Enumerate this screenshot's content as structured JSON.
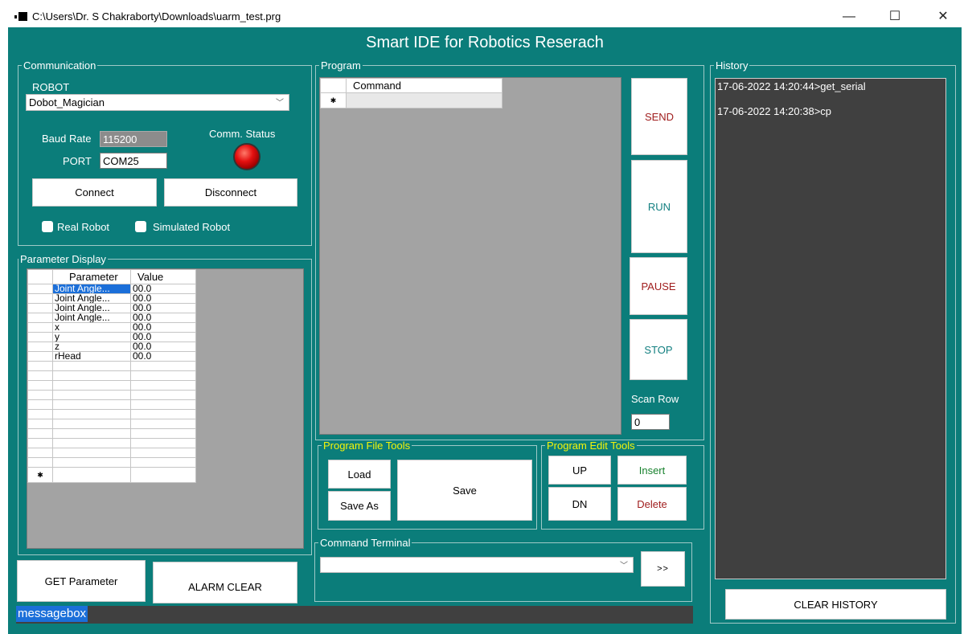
{
  "window": {
    "title": "C:\\Users\\Dr. S Chakraborty\\Downloads\\uarm_test.prg",
    "minimize": "—",
    "maximize": "☐",
    "close": "✕"
  },
  "app": {
    "heading": "Smart IDE for Robotics Reserach"
  },
  "colors": {
    "background": "#0b7d7a",
    "selection": "#1b6fd9",
    "dark_panel": "#404040"
  },
  "communication": {
    "legend": "Communication",
    "robot_label": "ROBOT",
    "robot_value": "Dobot_Magician",
    "baud_label": "Baud Rate",
    "baud_value": "115200",
    "port_label": "PORT",
    "port_value": "COM25",
    "status_label": "Comm. Status",
    "connect": "Connect",
    "disconnect": "Disconnect",
    "real_robot": "Real Robot",
    "simulated_robot": "Simulated Robot"
  },
  "params": {
    "legend": "Parameter Display",
    "col_param": "Parameter",
    "col_value": "Value",
    "rows": [
      [
        "Joint Angle...",
        "00.0"
      ],
      [
        "Joint Angle...",
        "00.0"
      ],
      [
        "Joint Angle...",
        "00.0"
      ],
      [
        "Joint Angle...",
        "00.0"
      ],
      [
        "x",
        "00.0"
      ],
      [
        "y",
        "00.0"
      ],
      [
        "z",
        "00.0"
      ],
      [
        "rHead",
        "00.0"
      ]
    ],
    "new_row_marker": "✱"
  },
  "bottom_left": {
    "get_parameter": "GET Parameter",
    "alarm_clear": "ALARM CLEAR"
  },
  "program": {
    "legend": "Program",
    "col_command": "Command",
    "new_row_marker": "✱",
    "send": "SEND",
    "run": "RUN",
    "pause": "PAUSE",
    "stop": "STOP",
    "scan_row_label": "Scan Row",
    "scan_row_value": "0"
  },
  "file_tools": {
    "legend": "Program File Tools",
    "load": "Load",
    "save_as": "Save As",
    "save": "Save"
  },
  "edit_tools": {
    "legend": "Program Edit Tools",
    "up": "UP",
    "insert": "Insert",
    "dn": "DN",
    "delete": "Delete"
  },
  "terminal": {
    "legend": "Command Terminal",
    "value": "",
    "send": ">>"
  },
  "history": {
    "legend": "History",
    "entries": [
      "17-06-2022 14:20:44>get_serial",
      "17-06-2022 14:20:38>cp"
    ],
    "clear": "CLEAR HISTORY"
  },
  "messagebox": {
    "text": "messagebox"
  }
}
